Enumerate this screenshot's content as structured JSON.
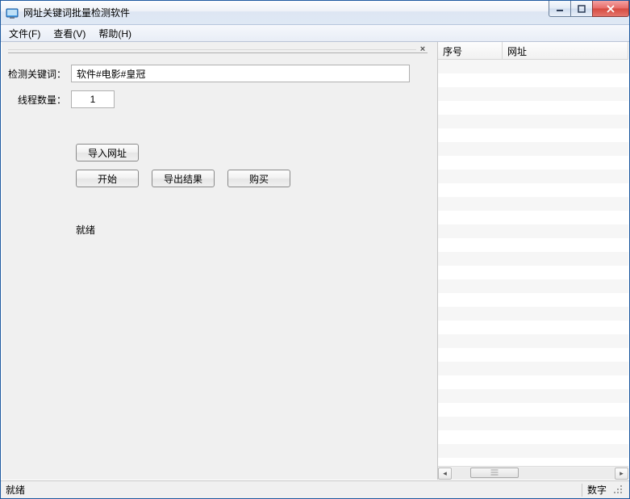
{
  "window": {
    "title": "网址关键词批量检测软件"
  },
  "menubar": {
    "file": "文件(F)",
    "view": "查看(V)",
    "help": "帮助(H)"
  },
  "form": {
    "keywords_label": "检测关键词：",
    "keywords_value": "软件#电影#皇冠",
    "threads_label": "线程数量：",
    "threads_value": "1"
  },
  "buttons": {
    "import": "导入网址",
    "start": "开始",
    "export": "导出结果",
    "buy": "购买"
  },
  "status": {
    "pane": "就绪",
    "bar_left": "就绪",
    "bar_right": "数字"
  },
  "list": {
    "col_index": "序号",
    "col_url": "网址",
    "rows": []
  }
}
